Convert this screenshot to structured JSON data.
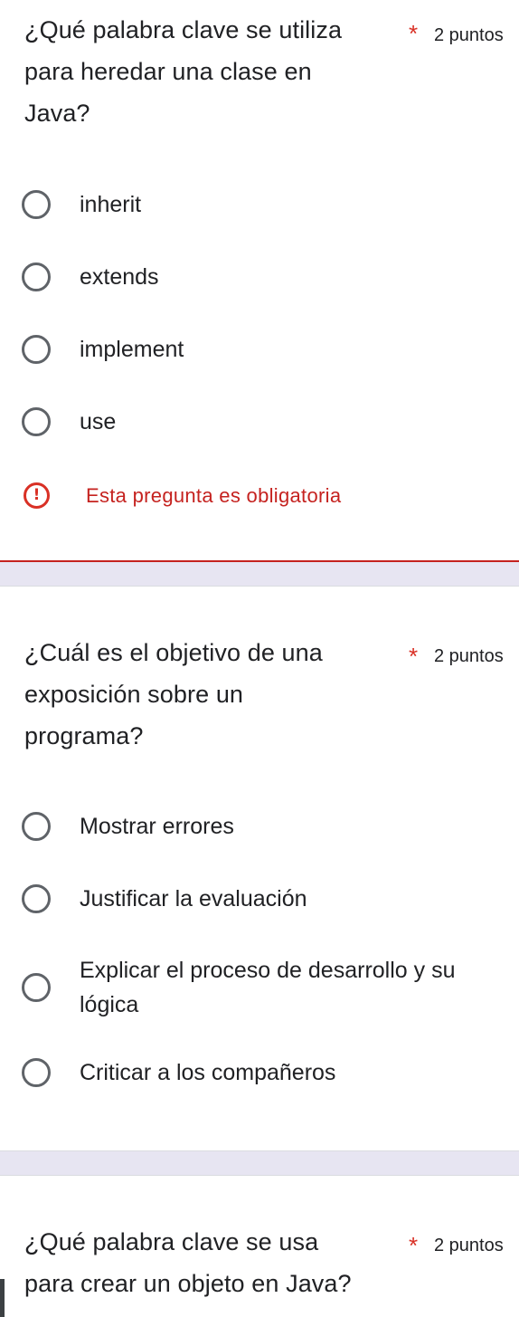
{
  "questions": [
    {
      "title": "¿Qué palabra clave se utiliza para heredar una clase en Java?",
      "title_lines": [
        "¿Qué palabra clave se utiliza",
        "para heredar una clase en",
        "Java?"
      ],
      "required_mark": "*",
      "points": "2 puntos",
      "options": [
        "inherit",
        "extends",
        "implement",
        "use"
      ],
      "error": {
        "icon": "!",
        "text": "Esta pregunta es obligatoria"
      }
    },
    {
      "title": "¿Cuál es el objetivo de una exposición sobre un programa?",
      "title_lines": [
        "¿Cuál es el objetivo de una",
        "exposición sobre un",
        "programa?"
      ],
      "required_mark": "*",
      "points": "2 puntos",
      "options": [
        "Mostrar errores",
        "Justificar la evaluación",
        "Explicar el proceso de desarrollo y su lógica",
        "Criticar a los compañeros"
      ]
    },
    {
      "title": "¿Qué palabra clave se usa para crear un objeto en Java?",
      "title_lines": [
        "¿Qué palabra clave se usa",
        "para crear un objeto en Java?"
      ],
      "required_mark": "*",
      "points": "2 puntos"
    }
  ],
  "colors": {
    "background": "#e7e5f2",
    "card": "#ffffff",
    "error": "#c5221f",
    "required": "#d93025",
    "radio_border": "#5f6368"
  },
  "icons": {
    "radio": "radio-unchecked-icon",
    "error": "error-circle-icon"
  }
}
